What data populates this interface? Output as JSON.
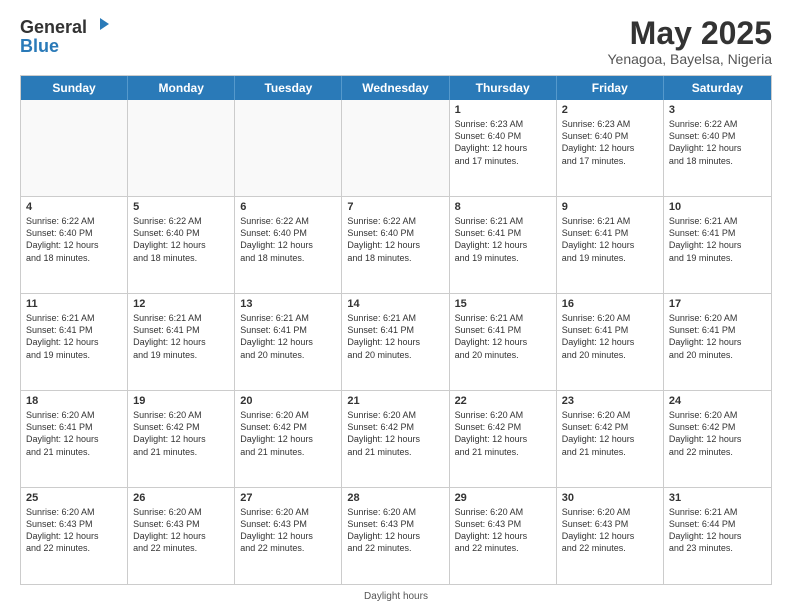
{
  "logo": {
    "line1": "General",
    "line2": "Blue"
  },
  "title": "May 2025",
  "subtitle": "Yenagoa, Bayelsa, Nigeria",
  "days_of_week": [
    "Sunday",
    "Monday",
    "Tuesday",
    "Wednesday",
    "Thursday",
    "Friday",
    "Saturday"
  ],
  "footer_text": "Daylight hours",
  "weeks": [
    [
      {
        "day": "",
        "info": "",
        "empty": true
      },
      {
        "day": "",
        "info": "",
        "empty": true
      },
      {
        "day": "",
        "info": "",
        "empty": true
      },
      {
        "day": "",
        "info": "",
        "empty": true
      },
      {
        "day": "1",
        "info": "Sunrise: 6:23 AM\nSunset: 6:40 PM\nDaylight: 12 hours\nand 17 minutes.",
        "empty": false
      },
      {
        "day": "2",
        "info": "Sunrise: 6:23 AM\nSunset: 6:40 PM\nDaylight: 12 hours\nand 17 minutes.",
        "empty": false
      },
      {
        "day": "3",
        "info": "Sunrise: 6:22 AM\nSunset: 6:40 PM\nDaylight: 12 hours\nand 18 minutes.",
        "empty": false
      }
    ],
    [
      {
        "day": "4",
        "info": "Sunrise: 6:22 AM\nSunset: 6:40 PM\nDaylight: 12 hours\nand 18 minutes.",
        "empty": false
      },
      {
        "day": "5",
        "info": "Sunrise: 6:22 AM\nSunset: 6:40 PM\nDaylight: 12 hours\nand 18 minutes.",
        "empty": false
      },
      {
        "day": "6",
        "info": "Sunrise: 6:22 AM\nSunset: 6:40 PM\nDaylight: 12 hours\nand 18 minutes.",
        "empty": false
      },
      {
        "day": "7",
        "info": "Sunrise: 6:22 AM\nSunset: 6:40 PM\nDaylight: 12 hours\nand 18 minutes.",
        "empty": false
      },
      {
        "day": "8",
        "info": "Sunrise: 6:21 AM\nSunset: 6:41 PM\nDaylight: 12 hours\nand 19 minutes.",
        "empty": false
      },
      {
        "day": "9",
        "info": "Sunrise: 6:21 AM\nSunset: 6:41 PM\nDaylight: 12 hours\nand 19 minutes.",
        "empty": false
      },
      {
        "day": "10",
        "info": "Sunrise: 6:21 AM\nSunset: 6:41 PM\nDaylight: 12 hours\nand 19 minutes.",
        "empty": false
      }
    ],
    [
      {
        "day": "11",
        "info": "Sunrise: 6:21 AM\nSunset: 6:41 PM\nDaylight: 12 hours\nand 19 minutes.",
        "empty": false
      },
      {
        "day": "12",
        "info": "Sunrise: 6:21 AM\nSunset: 6:41 PM\nDaylight: 12 hours\nand 19 minutes.",
        "empty": false
      },
      {
        "day": "13",
        "info": "Sunrise: 6:21 AM\nSunset: 6:41 PM\nDaylight: 12 hours\nand 20 minutes.",
        "empty": false
      },
      {
        "day": "14",
        "info": "Sunrise: 6:21 AM\nSunset: 6:41 PM\nDaylight: 12 hours\nand 20 minutes.",
        "empty": false
      },
      {
        "day": "15",
        "info": "Sunrise: 6:21 AM\nSunset: 6:41 PM\nDaylight: 12 hours\nand 20 minutes.",
        "empty": false
      },
      {
        "day": "16",
        "info": "Sunrise: 6:20 AM\nSunset: 6:41 PM\nDaylight: 12 hours\nand 20 minutes.",
        "empty": false
      },
      {
        "day": "17",
        "info": "Sunrise: 6:20 AM\nSunset: 6:41 PM\nDaylight: 12 hours\nand 20 minutes.",
        "empty": false
      }
    ],
    [
      {
        "day": "18",
        "info": "Sunrise: 6:20 AM\nSunset: 6:41 PM\nDaylight: 12 hours\nand 21 minutes.",
        "empty": false
      },
      {
        "day": "19",
        "info": "Sunrise: 6:20 AM\nSunset: 6:42 PM\nDaylight: 12 hours\nand 21 minutes.",
        "empty": false
      },
      {
        "day": "20",
        "info": "Sunrise: 6:20 AM\nSunset: 6:42 PM\nDaylight: 12 hours\nand 21 minutes.",
        "empty": false
      },
      {
        "day": "21",
        "info": "Sunrise: 6:20 AM\nSunset: 6:42 PM\nDaylight: 12 hours\nand 21 minutes.",
        "empty": false
      },
      {
        "day": "22",
        "info": "Sunrise: 6:20 AM\nSunset: 6:42 PM\nDaylight: 12 hours\nand 21 minutes.",
        "empty": false
      },
      {
        "day": "23",
        "info": "Sunrise: 6:20 AM\nSunset: 6:42 PM\nDaylight: 12 hours\nand 21 minutes.",
        "empty": false
      },
      {
        "day": "24",
        "info": "Sunrise: 6:20 AM\nSunset: 6:42 PM\nDaylight: 12 hours\nand 22 minutes.",
        "empty": false
      }
    ],
    [
      {
        "day": "25",
        "info": "Sunrise: 6:20 AM\nSunset: 6:43 PM\nDaylight: 12 hours\nand 22 minutes.",
        "empty": false
      },
      {
        "day": "26",
        "info": "Sunrise: 6:20 AM\nSunset: 6:43 PM\nDaylight: 12 hours\nand 22 minutes.",
        "empty": false
      },
      {
        "day": "27",
        "info": "Sunrise: 6:20 AM\nSunset: 6:43 PM\nDaylight: 12 hours\nand 22 minutes.",
        "empty": false
      },
      {
        "day": "28",
        "info": "Sunrise: 6:20 AM\nSunset: 6:43 PM\nDaylight: 12 hours\nand 22 minutes.",
        "empty": false
      },
      {
        "day": "29",
        "info": "Sunrise: 6:20 AM\nSunset: 6:43 PM\nDaylight: 12 hours\nand 22 minutes.",
        "empty": false
      },
      {
        "day": "30",
        "info": "Sunrise: 6:20 AM\nSunset: 6:43 PM\nDaylight: 12 hours\nand 22 minutes.",
        "empty": false
      },
      {
        "day": "31",
        "info": "Sunrise: 6:21 AM\nSunset: 6:44 PM\nDaylight: 12 hours\nand 23 minutes.",
        "empty": false
      }
    ]
  ]
}
